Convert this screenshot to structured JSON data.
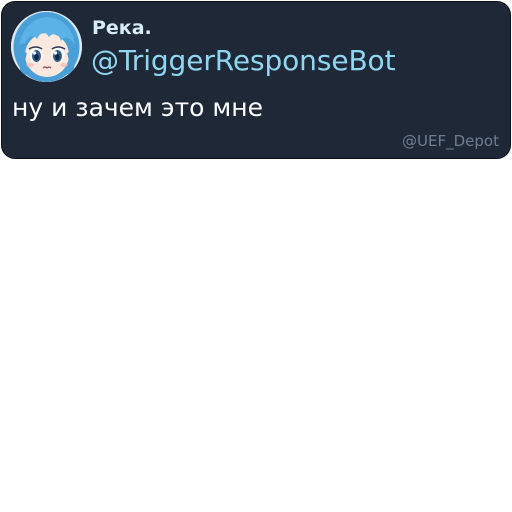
{
  "post": {
    "display_name": "Река.",
    "handle": "@TriggerResponseBot",
    "message": "ну и зачем это мне",
    "watermark": "@UEF_Depot",
    "avatar_icon": "anime-girl-avatar"
  },
  "colors": {
    "card_background": "#1e2837",
    "display_name": "#d8ecf7",
    "handle": "#8fd6f2",
    "message": "#ffffff",
    "watermark": "#6f7e8f"
  }
}
